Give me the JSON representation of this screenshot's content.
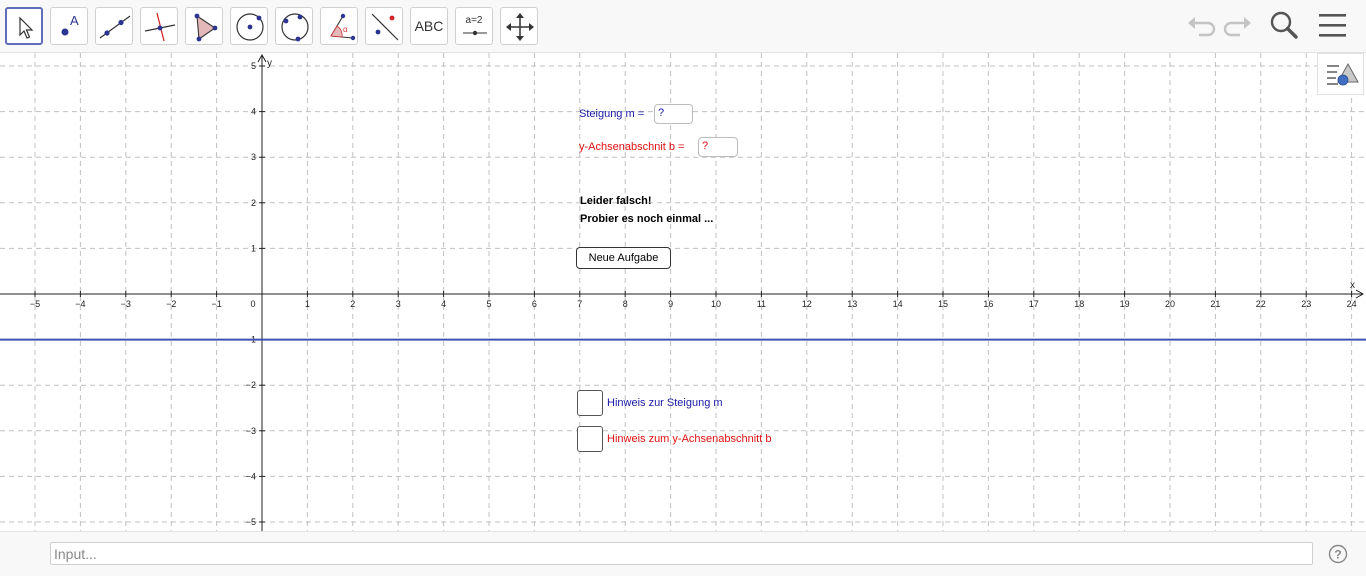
{
  "toolbar": {
    "text_tool_label": "ABC",
    "slider_tool_label": "a=2"
  },
  "input_bar": {
    "placeholder": "Input..."
  },
  "axes": {
    "x_label": "x",
    "y_label": "y",
    "x_ticks": [
      -5,
      -4,
      -3,
      -2,
      -1,
      0,
      1,
      2,
      3,
      4,
      5,
      6,
      7,
      8,
      9,
      10,
      11,
      12,
      13,
      14,
      15,
      16,
      17,
      18,
      19,
      20,
      21,
      22,
      23,
      24
    ],
    "y_ticks": [
      5,
      4,
      3,
      2,
      1,
      -1,
      -2,
      -3,
      -4,
      -5
    ],
    "x_range": [
      -5.7,
      24.3
    ],
    "y_range": [
      -5.3,
      5.3
    ],
    "grid": true
  },
  "line": {
    "equation_y": -1,
    "color": "#3f51b5"
  },
  "form": {
    "slope_label": "Steigung m =",
    "slope_value": "?",
    "intercept_label": "y-Achsenabschnit b =",
    "intercept_value": "?",
    "feedback_line1": "Leider falsch!",
    "feedback_line2": "Probier es noch einmal ...",
    "new_task_button": "Neue Aufgabe",
    "hint_slope_label": "Hinweis zur Steigung m",
    "hint_intercept_label": "Hinweis zum y-Achsenabschnitt b"
  },
  "colors": {
    "slope_text": "#1a1aa6",
    "intercept_text": "#e01010",
    "accent": "#5f6dbb"
  },
  "icons": [
    "move-cursor-icon",
    "point-icon",
    "line-icon",
    "perpendicular-line-icon",
    "polygon-icon",
    "circle-center-icon",
    "circle-three-points-icon",
    "angle-icon",
    "reflect-icon",
    "text-icon",
    "slider-icon",
    "move-graphics-view-icon",
    "undo-icon",
    "redo-icon",
    "search-icon",
    "menu-icon",
    "style-bar-icon",
    "help-icon"
  ]
}
